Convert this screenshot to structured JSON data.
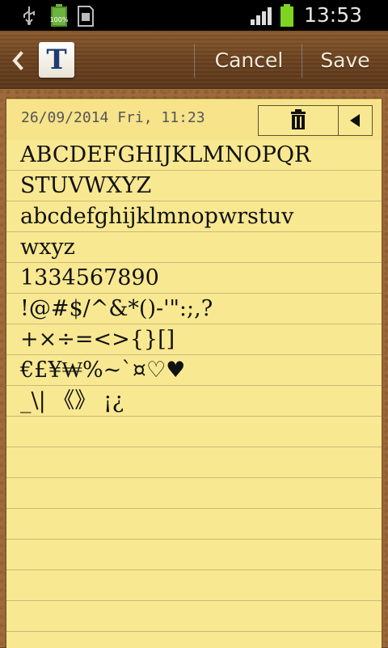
{
  "status_bar": {
    "battery_percent": "100%",
    "time": "13:53"
  },
  "action_bar": {
    "app_icon_letter": "T",
    "cancel_label": "Cancel",
    "save_label": "Save"
  },
  "note": {
    "date": "26/09/2014 Fri, 11:23",
    "lines": [
      "ABCDEFGHIJKLMNOPQR",
      "STUVWXYZ",
      "abcdefghijklmnopwrstuv",
      "wxyz",
      "1334567890",
      "!@#$/^&*()-'\":;,?",
      "+×÷=<>{}[]",
      "€£¥₩%~`¤♡♥",
      "_\\| 《》 ¡¿"
    ]
  },
  "colors": {
    "paper": "#f8e891",
    "wood": "#6d4320",
    "text": "#111111"
  }
}
